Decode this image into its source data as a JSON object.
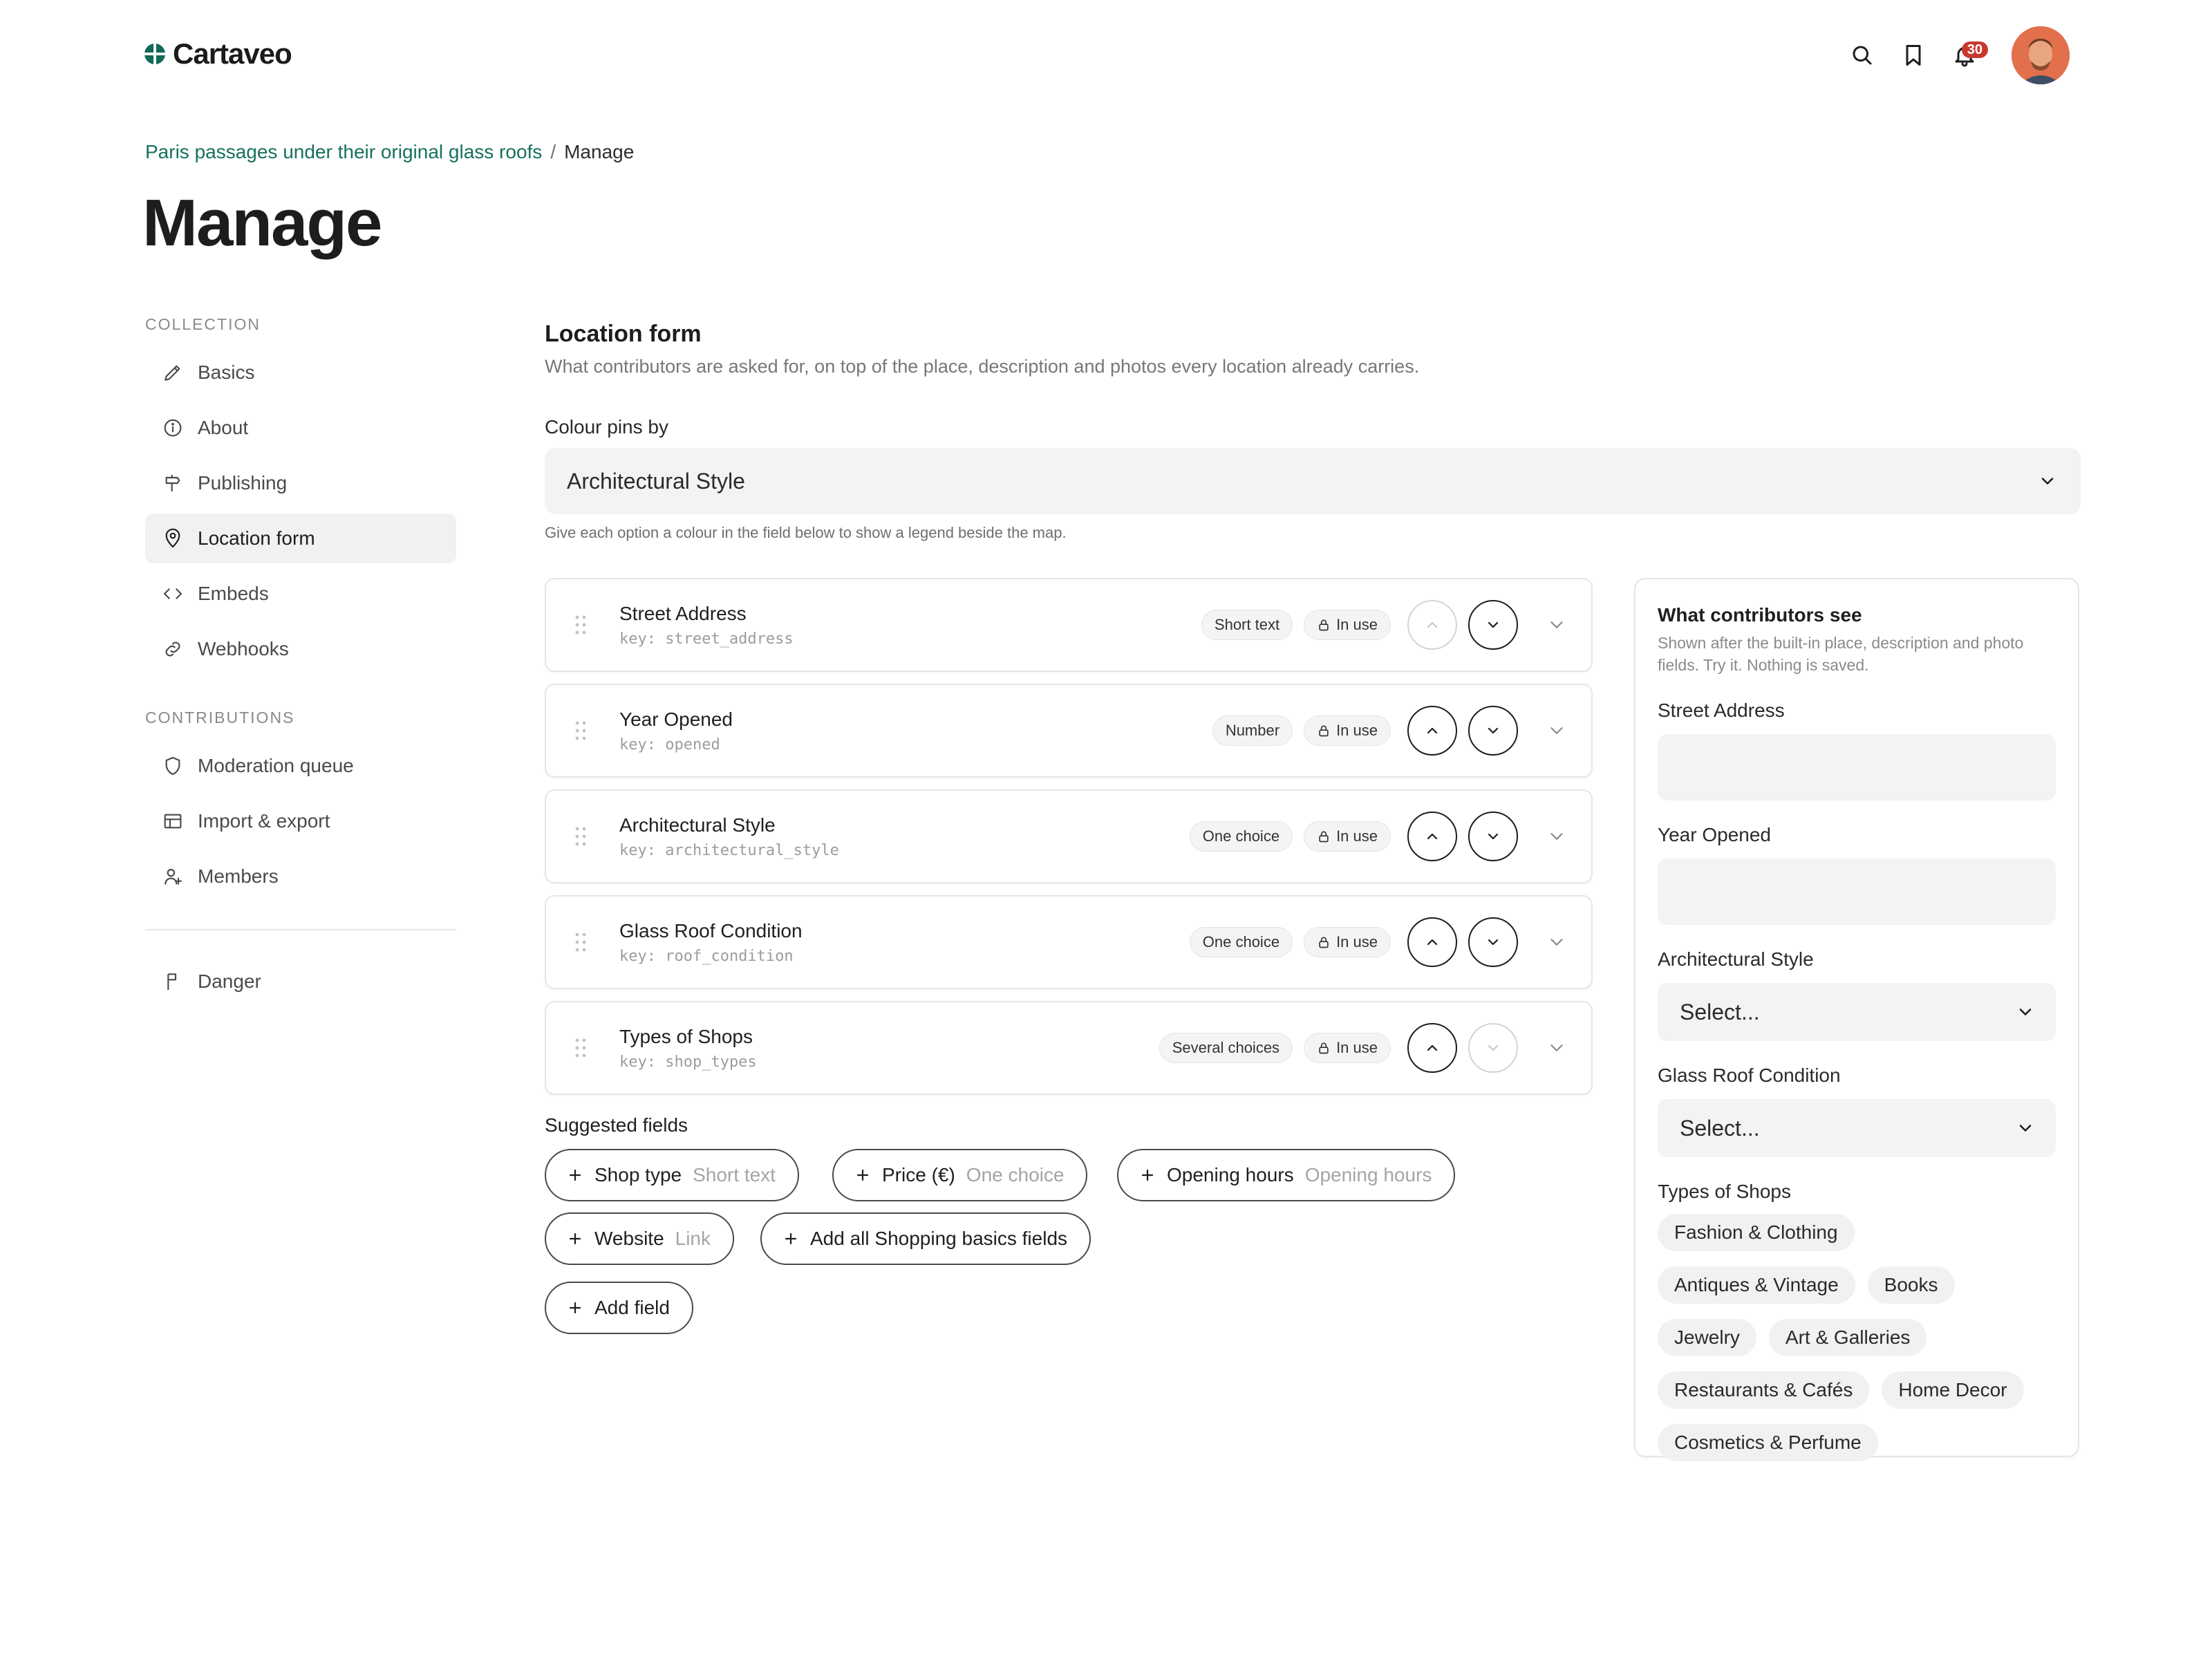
{
  "app": {
    "name": "Cartaveo",
    "brand_color": "#0f6b57"
  },
  "header": {
    "notifications_count": "30"
  },
  "breadcrumb": {
    "parent": "Paris passages under their original glass roofs",
    "separator": "/",
    "current": "Manage"
  },
  "page_title": "Manage",
  "sidebar": {
    "group_collection": "COLLECTION",
    "group_contributions": "CONTRIBUTIONS",
    "items": [
      {
        "label": "Basics",
        "icon": "pencil-icon"
      },
      {
        "label": "About",
        "icon": "info-icon"
      },
      {
        "label": "Publishing",
        "icon": "signpost-icon"
      },
      {
        "label": "Location form",
        "icon": "map-pin-icon",
        "active": true
      },
      {
        "label": "Embeds",
        "icon": "code-icon"
      },
      {
        "label": "Webhooks",
        "icon": "link-icon"
      },
      {
        "label": "Moderation queue",
        "icon": "shield-icon"
      },
      {
        "label": "Import & export",
        "icon": "table-icon"
      },
      {
        "label": "Members",
        "icon": "user-plus-icon"
      },
      {
        "label": "Danger",
        "icon": "flag-icon"
      }
    ]
  },
  "main": {
    "title": "Location form",
    "description": "What contributors are asked for, on top of the place, description and photos every location already carries.",
    "colour_pins_label": "Colour pins by",
    "colour_pins_value": "Architectural Style",
    "hint": "Give each option a colour in the field below to show a legend beside the map.",
    "in_use_label": "In use",
    "fields": [
      {
        "name": "Street Address",
        "key": "key: street_address",
        "type": "Short text",
        "up_enabled": false,
        "down_enabled": true
      },
      {
        "name": "Year Opened",
        "key": "key: opened",
        "type": "Number",
        "up_enabled": true,
        "down_enabled": true
      },
      {
        "name": "Architectural Style",
        "key": "key: architectural_style",
        "type": "One choice",
        "up_enabled": true,
        "down_enabled": true
      },
      {
        "name": "Glass Roof Condition",
        "key": "key: roof_condition",
        "type": "One choice",
        "up_enabled": true,
        "down_enabled": true
      },
      {
        "name": "Types of Shops",
        "key": "key: shop_types",
        "type": "Several choices",
        "up_enabled": true,
        "down_enabled": false
      }
    ],
    "suggested_title": "Suggested fields",
    "suggested": [
      {
        "label": "Shop type",
        "type": "Short text"
      },
      {
        "label": "Price (€)",
        "type": "One choice"
      },
      {
        "label": "Opening hours",
        "type": "Opening hours"
      },
      {
        "label": "Website",
        "type": "Link"
      }
    ],
    "add_all_label": "Add all Shopping basics fields",
    "add_field_label": "Add field"
  },
  "preview": {
    "title": "What contributors see",
    "description": "Shown after the built-in place, description and photo fields. Try it. Nothing is saved.",
    "street_address_label": "Street Address",
    "year_opened_label": "Year Opened",
    "architectural_style_label": "Architectural Style",
    "architectural_style_placeholder": "Select...",
    "roof_condition_label": "Glass Roof Condition",
    "roof_condition_placeholder": "Select...",
    "shop_types_label": "Types of Shops",
    "shop_types": [
      "Fashion & Clothing",
      "Antiques & Vintage",
      "Books",
      "Jewelry",
      "Art & Galleries",
      "Restaurants & Cafés",
      "Home Decor",
      "Cosmetics & Perfume"
    ]
  }
}
